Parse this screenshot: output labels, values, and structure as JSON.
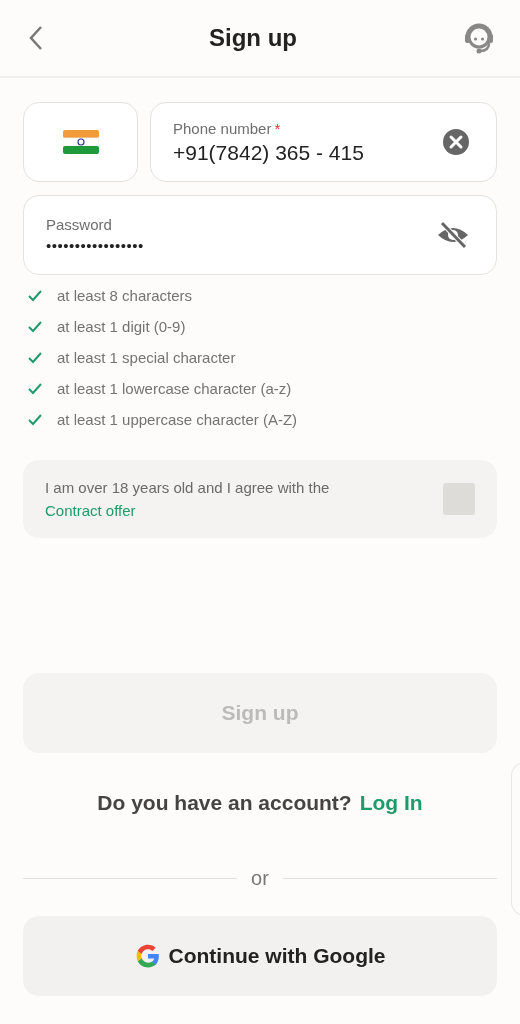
{
  "header": {
    "title": "Sign up"
  },
  "phone": {
    "label": "Phone number",
    "required": true,
    "required_mark": "*",
    "value": "+91(7842) 365 - 415"
  },
  "password": {
    "label": "Password",
    "value": "•••••••••••••••••",
    "visible": false
  },
  "requirements": [
    {
      "text": "at least 8 characters",
      "met": true
    },
    {
      "text": "at least 1 digit (0-9)",
      "met": true
    },
    {
      "text": "at least 1 special character",
      "met": true
    },
    {
      "text": "at least 1 lowercase character (a-z)",
      "met": true
    },
    {
      "text": "at least 1 uppercase character (A-Z)",
      "met": true
    }
  ],
  "agreement": {
    "text": "I am over 18 years old and I agree with the",
    "link": "Contract offer",
    "checked": false
  },
  "signup_button": {
    "label": "Sign up",
    "disabled": true
  },
  "login_prompt": {
    "text": "Do you have an account?",
    "link": "Log In"
  },
  "divider": "or",
  "google_button": {
    "label": "Continue with Google"
  }
}
